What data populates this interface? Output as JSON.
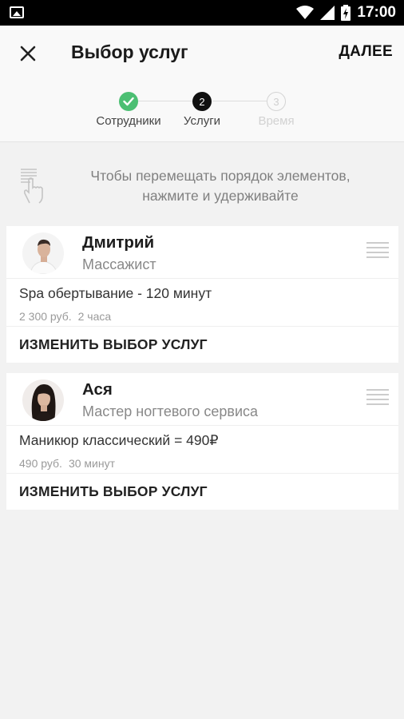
{
  "status_bar": {
    "time": "17:00",
    "icons": [
      "image-icon",
      "wifi-icon",
      "signal-icon",
      "battery-charging-icon"
    ]
  },
  "app_bar": {
    "title": "Выбор услуг",
    "next_label": "ДАЛЕЕ",
    "close_icon": "close-icon"
  },
  "stepper": {
    "steps": [
      {
        "label": "Сотрудники",
        "number": "1",
        "state": "done"
      },
      {
        "label": "Услуги",
        "number": "2",
        "state": "active"
      },
      {
        "label": "Время",
        "number": "3",
        "state": "inactive"
      }
    ],
    "done_color": "#4cbf73"
  },
  "hint": {
    "text": "Чтобы перемещать порядок элементов, нажмите и удерживайте",
    "icon": "touch-hold-icon"
  },
  "cards": [
    {
      "name": "Дмитрий",
      "role": "Массажист",
      "service": "Spa обертывание - 120 минут",
      "price": "2 300 руб.",
      "duration": "2 часа",
      "change_label": "ИЗМЕНИТЬ ВЫБОР УСЛУГ"
    },
    {
      "name": "Ася",
      "role": "Мастер ногтевого сервиса",
      "service": "Маникюр классический = 490₽",
      "price": "490 руб.",
      "duration": "30 минут",
      "change_label": "ИЗМЕНИТЬ ВЫБОР УСЛУГ"
    }
  ]
}
